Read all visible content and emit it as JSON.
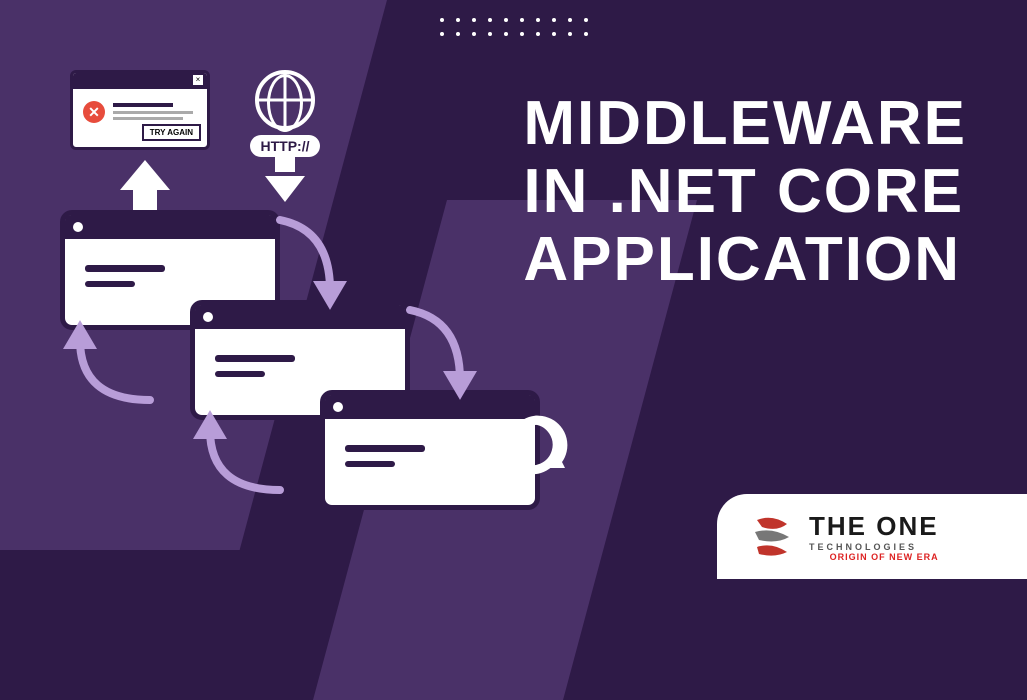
{
  "title": {
    "line1": "MIDDLEWARE",
    "line2": "IN .NET CORE",
    "line3": "APPLICATION"
  },
  "error_window": {
    "close_label": "×",
    "icon_label": "✕",
    "button_label": "TRY AGAIN"
  },
  "http_badge": "HTTP://",
  "logo": {
    "main": "THE ONE",
    "sub": "TECHNOLOGIES",
    "tag": "ORIGIN OF NEW ERA"
  }
}
